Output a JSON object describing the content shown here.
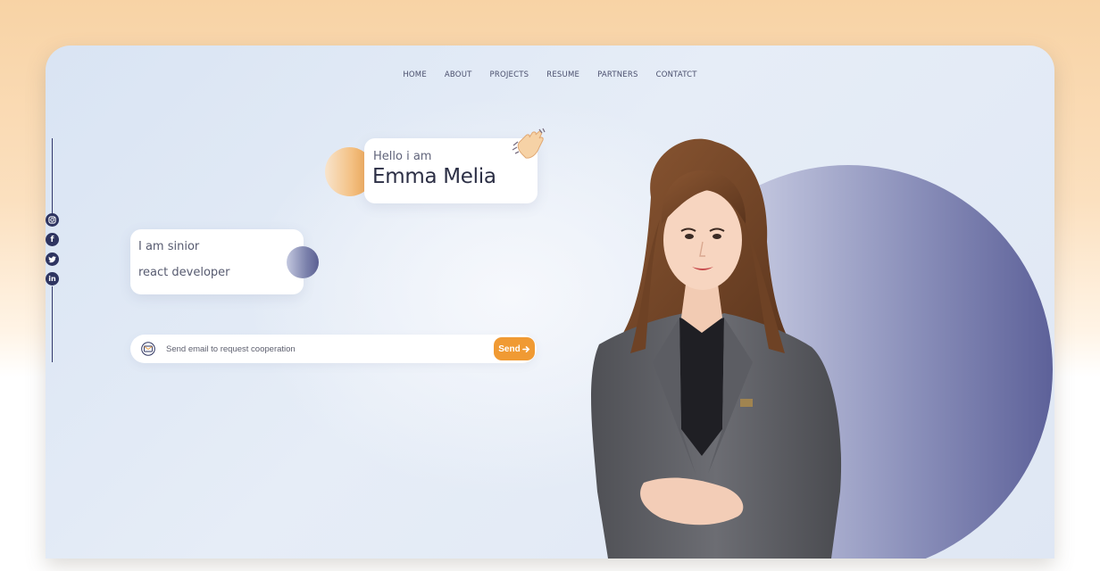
{
  "nav": {
    "items": [
      "HOME",
      "ABOUT",
      "PROJECTS",
      "RESUME",
      "PARTNERS",
      "CONTATCT"
    ]
  },
  "social": [
    {
      "name": "instagram-icon",
      "glyph": "◎"
    },
    {
      "name": "facebook-icon",
      "glyph": "f"
    },
    {
      "name": "twitter-icon",
      "glyph": "t"
    },
    {
      "name": "linkedin-icon",
      "glyph": "in"
    }
  ],
  "intro": {
    "greeting": "Hello i am",
    "name": "Emma Melia",
    "wave_icon": "waving-hand-icon"
  },
  "role": {
    "line1": "I am sinior",
    "line2": "react developer"
  },
  "contact": {
    "placeholder": "Send email to request cooperation",
    "send_label": "Send",
    "mail_icon": "mail-icon",
    "arrow_icon": "arrow-right-icon"
  },
  "colors": {
    "accent_orange": "#f09a33",
    "accent_navy": "#2e3460",
    "circle_purple": "#5d6199"
  }
}
